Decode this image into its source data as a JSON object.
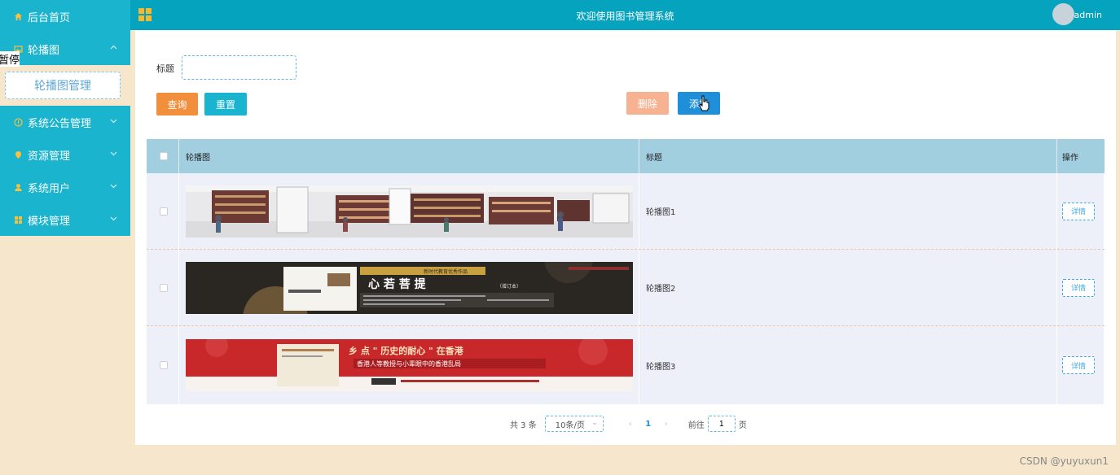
{
  "sidebar": {
    "items": [
      {
        "label": "后台首页",
        "icon": "home-icon"
      },
      {
        "label": "轮播图",
        "icon": "image-icon",
        "expanded": true
      },
      {
        "label": "系统公告管理",
        "icon": "info-icon"
      },
      {
        "label": "资源管理",
        "icon": "pin-icon"
      },
      {
        "label": "系统用户",
        "icon": "user-icon"
      },
      {
        "label": "模块管理",
        "icon": "grid-icon"
      }
    ],
    "submenu_active": "轮播图管理",
    "pause_label": "暂停"
  },
  "topbar": {
    "title": "欢迎使用图书管理系统",
    "user": "admin"
  },
  "search": {
    "label": "标题",
    "value": "",
    "placeholder": ""
  },
  "buttons": {
    "query": "查询",
    "reset": "重置",
    "delete": "删除",
    "add": "添加"
  },
  "table": {
    "headers": [
      "轮播图",
      "标题",
      "操作"
    ],
    "rows": [
      {
        "title": "轮播图1",
        "action": "详情"
      },
      {
        "title": "轮播图2",
        "action": "详情"
      },
      {
        "title": "轮播图3",
        "action": "详情"
      }
    ],
    "banner2": {
      "author": "肖燕拉",
      "tag": "新时代教育优秀作品",
      "heading": "心 若 菩 提",
      "edition": "（增订本）"
    },
    "banner3": {
      "heading": "乡 点 \" 历史的耐心 \" 在香港",
      "subheading": "香港人等教授与小辈眼中的香港乱局"
    }
  },
  "pagination": {
    "total": "共 3 条",
    "page_size": "10条/页",
    "prev": "‹",
    "current": "1",
    "next": "›",
    "goto_prefix": "前往",
    "goto_value": "1",
    "goto_suffix": "页"
  },
  "watermark": "CSDN @yuyuxun1",
  "colors": {
    "sidebar_menu": "#1ab4cf",
    "topbar": "#06a3be",
    "query": "#f28f3c",
    "reset": "#1ab4cf",
    "delete": "#f7b292",
    "add": "#1f8fd9"
  }
}
